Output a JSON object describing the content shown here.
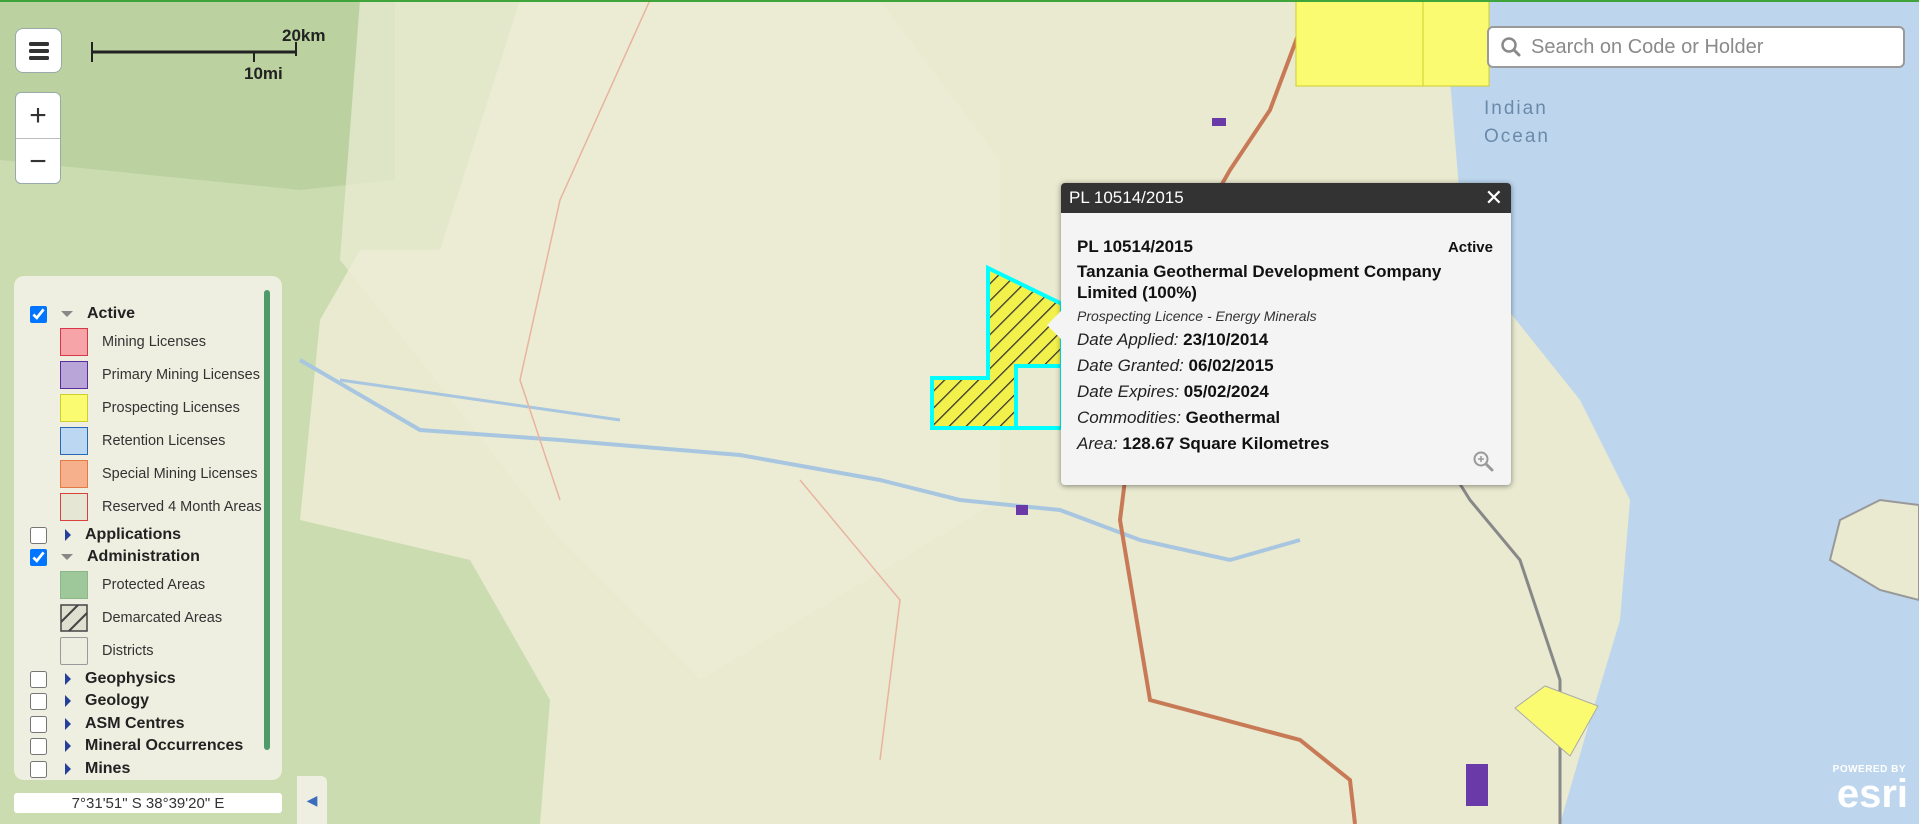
{
  "search": {
    "placeholder": "Search on Code or Holder"
  },
  "scale": {
    "km": "20km",
    "mi": "10mi"
  },
  "zoom": {
    "in": "+",
    "out": "−"
  },
  "map_labels": {
    "ocean_line1": "Indian",
    "ocean_line2": "Ocean"
  },
  "legend": {
    "active": {
      "label": "Active",
      "checked": true
    },
    "active_items": [
      {
        "label": "Mining Licenses",
        "fill": "#f7a4a8",
        "stroke": "#d9364a"
      },
      {
        "label": "Primary Mining Licenses",
        "fill": "#b9a5d8",
        "stroke": "#5a2e9a"
      },
      {
        "label": "Prospecting Licenses",
        "fill": "#fbfb72",
        "stroke": "#cfcf2a"
      },
      {
        "label": "Retention Licenses",
        "fill": "#bcd7f2",
        "stroke": "#2a67b5"
      },
      {
        "label": "Special Mining Licenses",
        "fill": "#f7b08c",
        "stroke": "#e47a45"
      },
      {
        "label": "Reserved 4 Month Areas",
        "fill": "#e6e6d4",
        "stroke": "#d9413c"
      }
    ],
    "applications": {
      "label": "Applications",
      "checked": false
    },
    "administration": {
      "label": "Administration",
      "checked": true
    },
    "admin_items": [
      {
        "label": "Protected Areas"
      },
      {
        "label": "Demarcated Areas"
      },
      {
        "label": "Districts"
      }
    ],
    "geophysics": {
      "label": "Geophysics",
      "checked": false
    },
    "geology": {
      "label": "Geology",
      "checked": false
    },
    "asm": {
      "label": "ASM Centres",
      "checked": false
    },
    "mineral": {
      "label": "Mineral Occurrences",
      "checked": false
    },
    "mines": {
      "label": "Mines",
      "checked": false
    }
  },
  "coords": "7°31'51\" S  38°39'20\" E",
  "popup": {
    "title": "PL 10514/2015",
    "id": "PL 10514/2015",
    "status": "Active",
    "holder": "Tanzania Geothermal Development Company Limited (100%)",
    "type": "Prospecting Licence - Energy Minerals",
    "rows": [
      {
        "key": "Date Applied:",
        "value": "23/10/2014"
      },
      {
        "key": "Date Granted:",
        "value": "06/02/2015"
      },
      {
        "key": "Date Expires:",
        "value": "05/02/2024"
      },
      {
        "key": "Commodities:",
        "value": "Geothermal"
      },
      {
        "key": "Area:",
        "value": "128.67 Square Kilometres"
      }
    ]
  },
  "esri": {
    "powered": "POWERED BY",
    "logo": "esri"
  },
  "colors": {
    "water": "#bdd6ee",
    "land": "#e9ead0",
    "protected": "#b5d09b",
    "road": "#c87a57",
    "highlight": "#00ffff",
    "prospecting": "#fbfb72"
  }
}
